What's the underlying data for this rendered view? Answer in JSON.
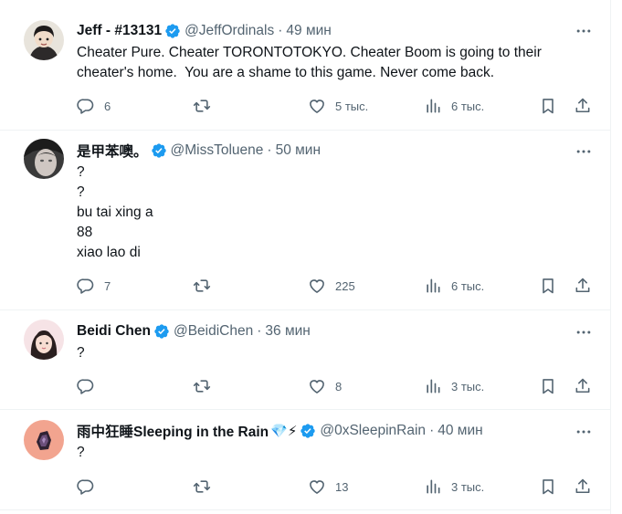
{
  "posts": [
    {
      "name": "Jeff - #13131",
      "handle": "@JeffOrdinals",
      "time": "49 мин",
      "lines": [
        "Cheater Pure. Cheater TORONTOTOKYO. Cheater Boom is going to their",
        "cheater's home.  You are a shame to this game. Never come back."
      ],
      "replies": "6",
      "reposts": "",
      "likes": "5 тыс.",
      "views": "6 тыс."
    },
    {
      "name": "是甲苯噢。",
      "handle": "@MissToluene",
      "time": "50 мин",
      "lines": [
        "?",
        "?",
        "bu tai xing a",
        "88",
        "xiao lao di"
      ],
      "replies": "7",
      "reposts": "",
      "likes": "225",
      "views": "6 тыс."
    },
    {
      "name": "Beidi Chen",
      "handle": "@BeidiChen",
      "time": "36 мин",
      "lines": [
        "?"
      ],
      "replies": "",
      "reposts": "",
      "likes": "8",
      "views": "3 тыс."
    },
    {
      "name": "雨中狂睡Sleeping in the Rain",
      "name_emoji": "💎⚡",
      "handle": "@0xSleepinRain",
      "time": "40 мин",
      "lines": [
        "?"
      ],
      "replies": "",
      "reposts": "",
      "likes": "13",
      "views": "3 тыс."
    }
  ],
  "icons": {
    "verified": "verified-badge-icon",
    "more": "more-icon",
    "reply": "reply-icon",
    "repost": "repost-icon",
    "like": "like-icon",
    "views": "views-icon",
    "bookmark": "bookmark-icon",
    "share": "share-icon"
  },
  "colors": {
    "verified": "#1d9bf0",
    "secondary": "#536471",
    "divider": "#eff3f4"
  }
}
